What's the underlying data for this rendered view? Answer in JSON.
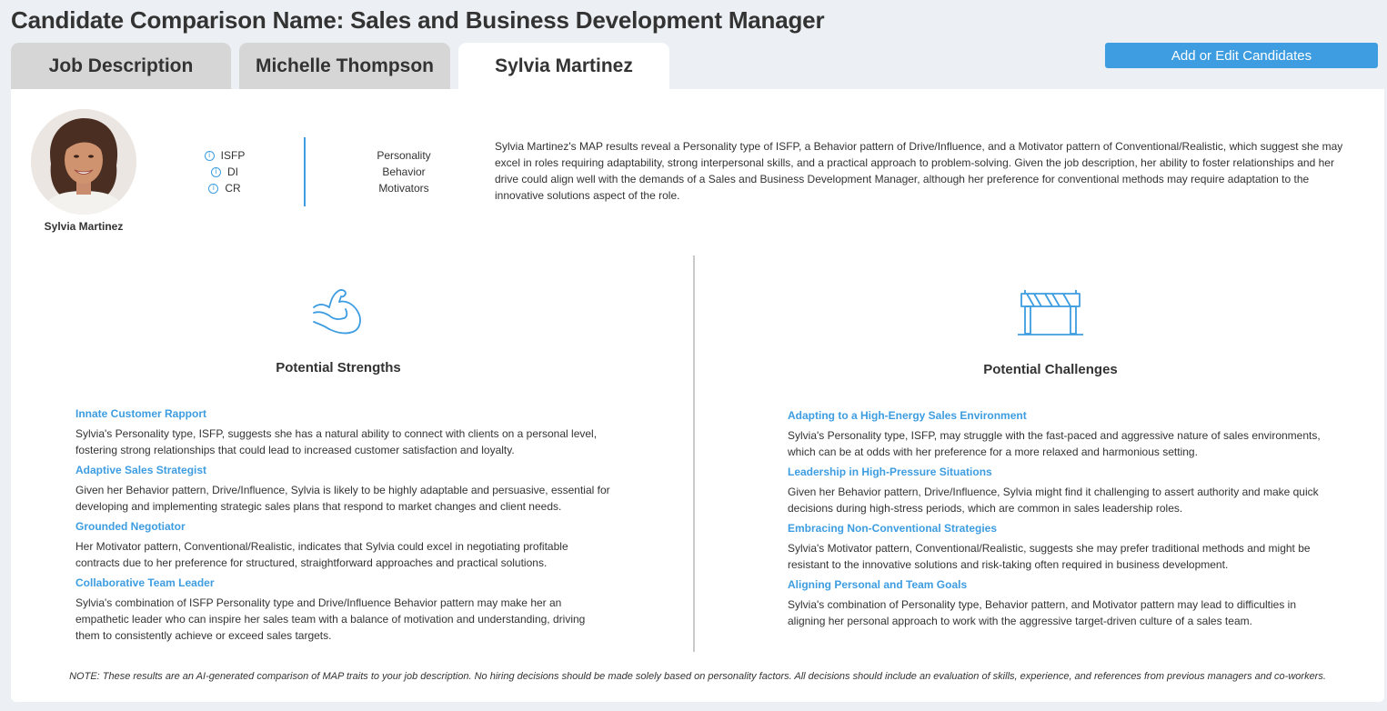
{
  "page": {
    "title": "Candidate Comparison Name: Sales and Business Development Manager"
  },
  "tabs": [
    {
      "label": "Job Description",
      "active": false
    },
    {
      "label": "Michelle Thompson",
      "active": false
    },
    {
      "label": "Sylvia Martinez",
      "active": true
    }
  ],
  "actions": {
    "add_edit_label": "Add or Edit Candidates"
  },
  "candidate": {
    "name": "Sylvia Martinez",
    "codes": [
      "ISFP",
      "DI",
      "CR"
    ],
    "code_labels": [
      "Personality",
      "Behavior",
      "Motivators"
    ],
    "summary": "Sylvia Martinez's MAP results reveal a Personality type of ISFP, a Behavior pattern of Drive/Influence, and a Motivator pattern of Conventional/Realistic, which suggest she may excel in roles requiring adaptability, strong interpersonal skills, and a practical approach to problem-solving. Given the job description, her ability to foster relationships and her drive could align well with the demands of a Sales and Business Development Manager, although her preference for conventional methods may require adaptation to the innovative solutions aspect of the role."
  },
  "strengths": {
    "title": "Potential Strengths",
    "icon": "flexed-arm-icon",
    "items": [
      {
        "title": "Innate Customer Rapport",
        "text": "Sylvia's Personality type, ISFP, suggests she has a natural ability to connect with clients on a personal level, fostering strong relationships that could lead to increased customer satisfaction and loyalty."
      },
      {
        "title": "Adaptive Sales Strategist",
        "text": "Given her Behavior pattern, Drive/Influence, Sylvia is likely to be highly adaptable and persuasive, essential for developing and implementing strategic sales plans that respond to market changes and client needs."
      },
      {
        "title": "Grounded Negotiator",
        "text": "Her Motivator pattern, Conventional/Realistic, indicates that Sylvia could excel in negotiating profitable contracts due to her preference for structured, straightforward approaches and practical solutions."
      },
      {
        "title": "Collaborative Team Leader",
        "text": "Sylvia's combination of ISFP Personality type and Drive/Influence Behavior pattern may make her an empathetic leader who can inspire her sales team with a balance of motivation and understanding, driving them to consistently achieve or exceed sales targets."
      }
    ]
  },
  "challenges": {
    "title": "Potential Challenges",
    "icon": "hurdle-barrier-icon",
    "items": [
      {
        "title": "Adapting to a High-Energy Sales Environment",
        "text": "Sylvia's Personality type, ISFP, may struggle with the fast-paced and aggressive nature of sales environments, which can be at odds with her preference for a more relaxed and harmonious setting."
      },
      {
        "title": "Leadership in High-Pressure Situations",
        "text": "Given her Behavior pattern, Drive/Influence, Sylvia might find it challenging to assert authority and make quick decisions during high-stress periods, which are common in sales leadership roles."
      },
      {
        "title": "Embracing Non-Conventional Strategies",
        "text": "Sylvia's Motivator pattern, Conventional/Realistic, suggests she may prefer traditional methods and might be resistant to the innovative solutions and risk-taking often required in business development."
      },
      {
        "title": "Aligning Personal and Team Goals",
        "text": "Sylvia's combination of Personality type, Behavior pattern, and Motivator pattern may lead to difficulties in aligning her personal approach to work with the aggressive target-driven culture of a sales team."
      }
    ]
  },
  "note": "NOTE: These results are an AI-generated comparison of MAP traits to your job description. No hiring decisions should be made solely based on personality factors. All decisions should include an evaluation of skills, experience, and references from previous managers and co-workers.",
  "colors": {
    "accent": "#3d9de0",
    "background": "#eceff3",
    "tab_inactive": "#d6d6d6"
  }
}
